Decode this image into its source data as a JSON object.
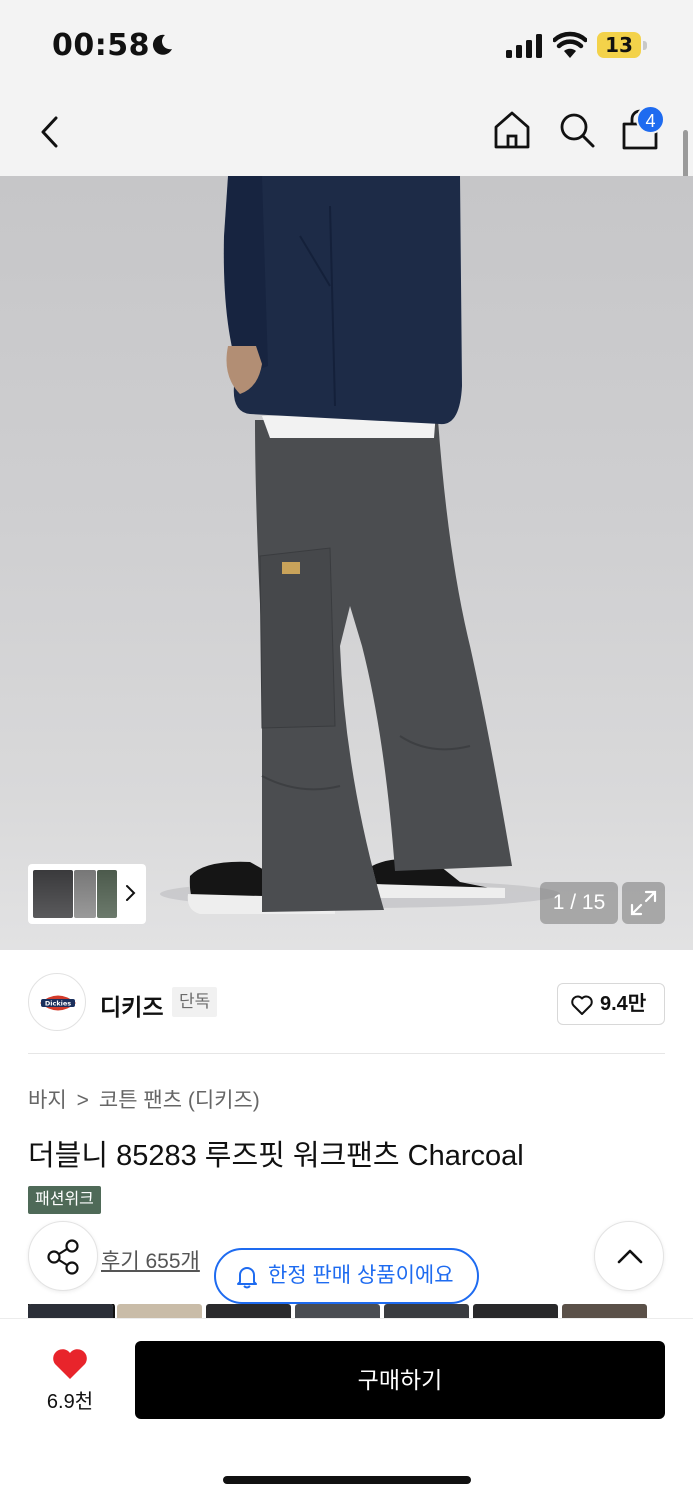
{
  "status_bar": {
    "time": "00:58",
    "battery_level": "13"
  },
  "nav": {
    "cart_count": "4"
  },
  "gallery": {
    "counter": "1 / 15"
  },
  "brand": {
    "name": "디키즈",
    "logo_text": "Dickies",
    "exclusive_label": "단독",
    "likes": "9.4만"
  },
  "product": {
    "breadcrumb": [
      "바지",
      "코튼 팬츠 (디키즈)"
    ],
    "breadcrumb_separator": ">",
    "title": "더블니 85283 루즈핏 워크팬츠 Charcoal",
    "tag": "패션위크",
    "reviews": "후기 655개",
    "limited_notice": "한정 판매 상품이에요"
  },
  "swatch_colors": [
    "#2b2f38",
    "#c9bca8",
    "#2a2a2c",
    "#4a4d52",
    "#3a3c40",
    "#28282a",
    "#5a5048"
  ],
  "bottom_bar": {
    "wish_count": "6.9천",
    "buy_label": "구매하기"
  },
  "colors": {
    "accent_blue": "#1e6bf0",
    "heart_red": "#e8242b",
    "tag_green": "#4f6a58"
  }
}
